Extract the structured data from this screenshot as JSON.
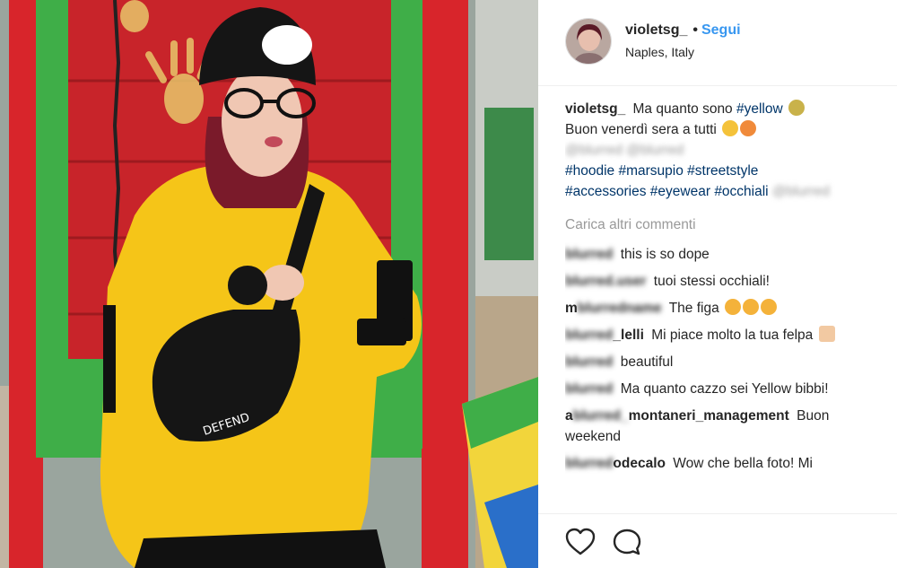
{
  "header": {
    "username": "violetsg_",
    "dot": "•",
    "follow_label": "Segui",
    "location": "Naples, Italy"
  },
  "caption": {
    "username": "violetsg_",
    "line1_text": "Ma quanto sono",
    "line1_tag": "#yellow",
    "line2_text": "Buon venerdì sera a tutti",
    "blurred_mentions": "@blurred @blurred",
    "tags_line1": [
      "#hoodie",
      "#marsupio",
      "#streetstyle"
    ],
    "tags_line2": [
      "#accessories",
      "#eyewear",
      "#occhiali"
    ],
    "blurred_tag": "@blurred"
  },
  "load_more_label": "Carica altri commenti",
  "comments": [
    {
      "user": "blurred",
      "text": "this is so dope"
    },
    {
      "user": "blurred.user",
      "text": "tuoi stessi occhiali!"
    },
    {
      "user_visible": "m",
      "user": "blurredname",
      "text": "The figa"
    },
    {
      "user": "blurred",
      "user_visible": "_lelli",
      "text": "Mi piace molto la tua felpa"
    },
    {
      "user": "blurred",
      "text": "beautiful"
    },
    {
      "user": "blurred",
      "text": "Ma quanto cazzo sei Yellow bibbi!"
    },
    {
      "user_visible": "a",
      "user": "blurred_",
      "user_suffix": "montaneri_management",
      "text": "Buon weekend"
    },
    {
      "user": "blurred",
      "user_suffix": "odecalo",
      "text": "Wow che bella foto! Mi"
    }
  ],
  "colors": {
    "follow": "#3897f0",
    "hashtag": "#003569",
    "muted": "#999999",
    "border": "#efefef"
  },
  "icons": {
    "like": "heart-outline-icon",
    "comment": "speech-bubble-icon"
  }
}
